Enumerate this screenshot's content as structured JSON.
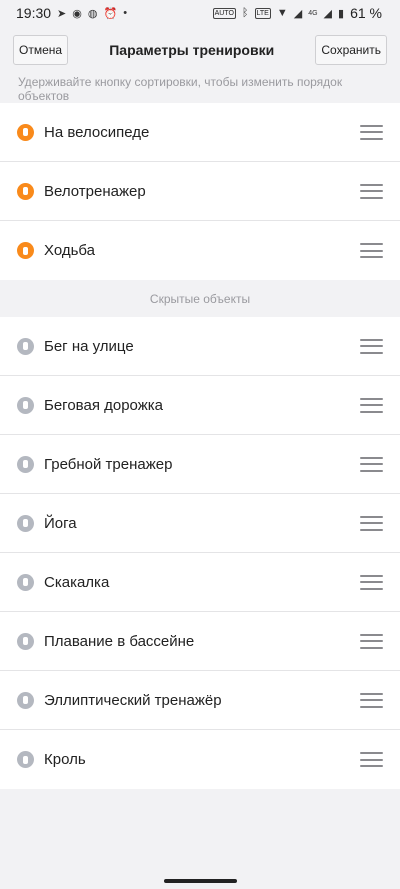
{
  "statusbar": {
    "time": "19:30",
    "auto_badge": "AUTO",
    "lte_badge": "LTE",
    "battery": "61 %",
    "network_badge": "4G"
  },
  "header": {
    "cancel_label": "Отмена",
    "title": "Параметры тренировки",
    "save_label": "Сохранить"
  },
  "hint": "Удерживайте кнопку сортировки, чтобы изменить порядок объектов",
  "active_items": [
    {
      "label": "На велосипеде",
      "icon": "bike-icon",
      "glyph": "🚲"
    },
    {
      "label": "Велотренажер",
      "icon": "exercise-bike-icon",
      "glyph": "⚲"
    },
    {
      "label": "Ходьба",
      "icon": "walking-icon",
      "glyph": "🚶"
    }
  ],
  "hidden_section_label": "Скрытые объекты",
  "hidden_items": [
    {
      "label": "Бег на улице",
      "icon": "running-icon",
      "glyph": "🏃"
    },
    {
      "label": "Беговая дорожка",
      "icon": "treadmill-icon",
      "glyph": "⚲"
    },
    {
      "label": "Гребной тренажер",
      "icon": "rowing-machine-icon",
      "glyph": "⚲"
    },
    {
      "label": "Йога",
      "icon": "yoga-icon",
      "glyph": "⚲"
    },
    {
      "label": "Скакалка",
      "icon": "jump-rope-icon",
      "glyph": "⚲"
    },
    {
      "label": "Плавание в бассейне",
      "icon": "swimming-icon",
      "glyph": "≈"
    },
    {
      "label": "Эллиптический тренажёр",
      "icon": "elliptical-icon",
      "glyph": "⚲"
    },
    {
      "label": "Кроль",
      "icon": "freestyle-swim-icon",
      "glyph": "⚲"
    }
  ],
  "colors": {
    "active_icon": "#f98a1b",
    "hidden_icon": "#b4b8c0",
    "background": "#f2f2f4"
  }
}
